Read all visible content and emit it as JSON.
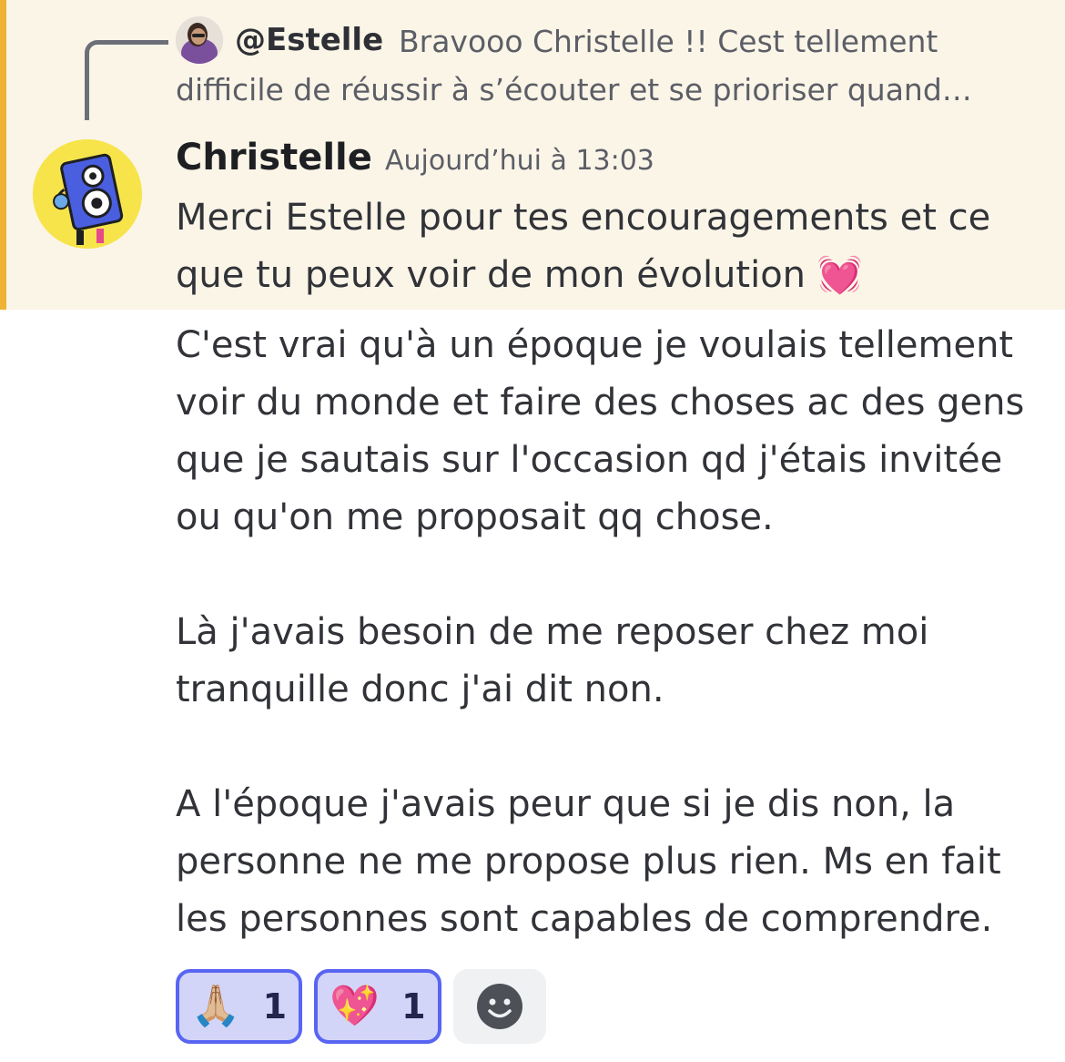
{
  "reply": {
    "author": "@Estelle",
    "preview_line1": "Bravooo Christelle !! Cest tellement",
    "preview_line2": "difficile de réussir à s’écouter et se prioriser quand…"
  },
  "message": {
    "author": "Christelle",
    "timestamp": "Aujourd’hui à 13:03",
    "lines": [
      "Merci Estelle pour tes encouragements et ce",
      "que tu peux voir de mon évolution",
      "C'est vrai qu'à un époque je voulais tellement",
      "voir du monde et faire des choses ac des gens",
      "que je sautais sur l'occasion qd j'étais invitée",
      "ou qu'on me proposait qq chose.",
      "Là j'avais besoin de me reposer chez moi",
      "tranquille donc j'ai dit non.",
      "A l'époque j'avais peur que si je dis non, la",
      "personne ne me propose plus rien. Ms en fait",
      "les personnes sont capables de comprendre."
    ],
    "inline_emoji": "💓"
  },
  "reactions": [
    {
      "emoji": "🙏🏼",
      "count": "1"
    },
    {
      "emoji": "💖",
      "count": "1"
    }
  ],
  "icons": {
    "add_reaction": "smiley-face-icon",
    "reply_avatar": "estelle-avatar",
    "avatar": "blue-speaker-character-avatar"
  },
  "colors": {
    "mention_highlight_bg": "#fbf5e8",
    "mention_highlight_bar": "#f0b232",
    "reaction_active_bg": "#d2d5f8",
    "reaction_active_border": "#5865f2",
    "avatar_bg": "#f7e44a"
  }
}
